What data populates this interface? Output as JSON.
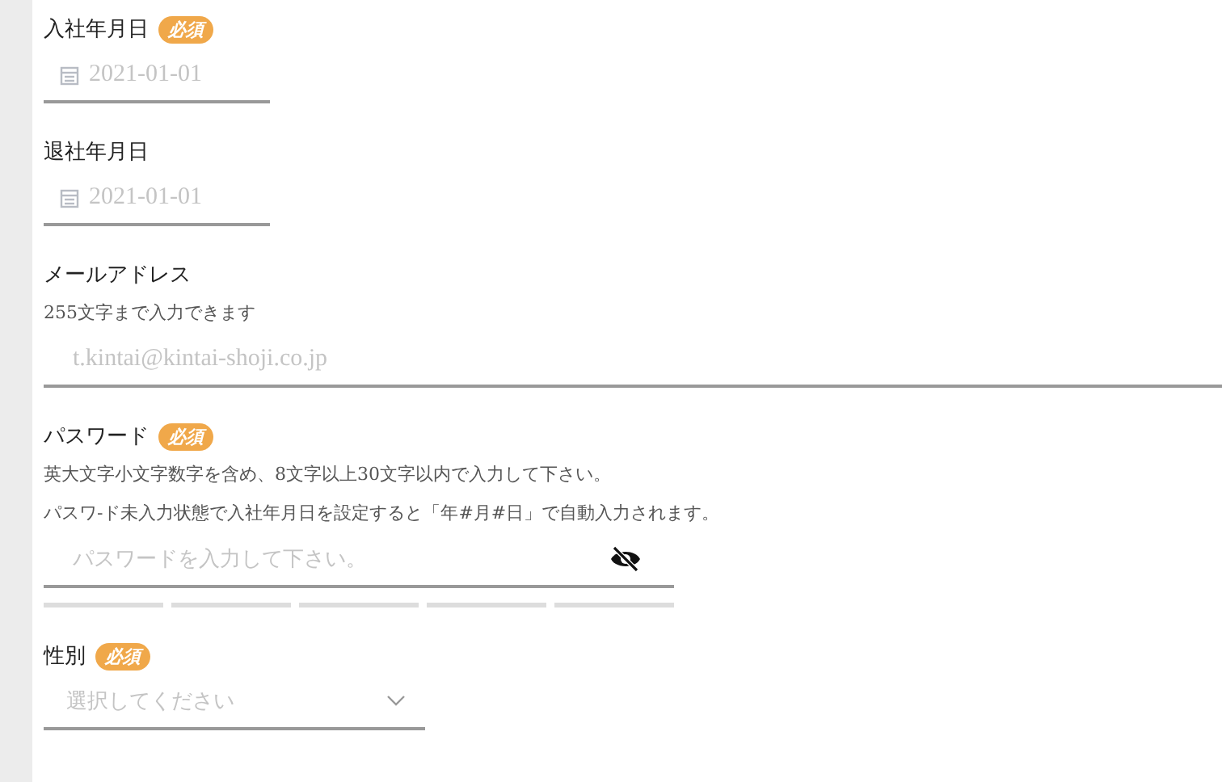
{
  "fields": [
    {
      "kind": "date",
      "label": "入社年月日",
      "required_badge": "必須",
      "placeholder": "2021-01-01"
    },
    {
      "kind": "date",
      "label": "退社年月日",
      "placeholder": "2021-01-01"
    },
    {
      "kind": "email",
      "label": "メールアドレス",
      "hints": [
        "255文字まで入力できます"
      ],
      "placeholder": "t.kintai@kintai-shoji.co.jp"
    },
    {
      "kind": "password",
      "label": "パスワード",
      "required_badge": "必須",
      "hints": [
        "英大文字小文字数字を含め、8文字以上30文字以内で入力して下さい。",
        "パスワ-ド未入力状態で入社年月日を設定すると「年#月#日」で自動入力されます。"
      ],
      "placeholder": "パスワードを入力して下さい。",
      "strength_meter": true
    },
    {
      "kind": "select",
      "label": "性別",
      "required_badge": "必須",
      "placeholder": "選択してください"
    }
  ]
}
